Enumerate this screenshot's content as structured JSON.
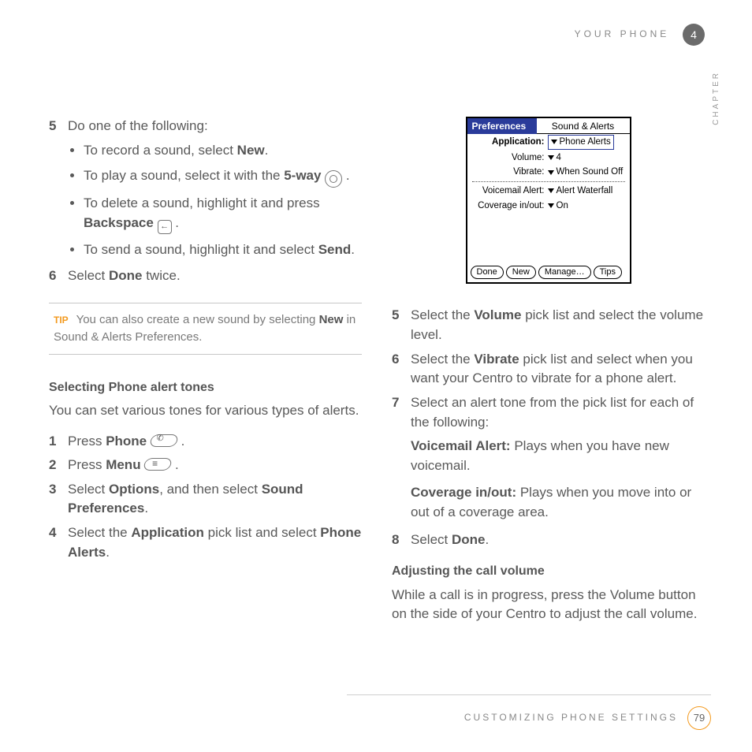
{
  "header": {
    "section": "YOUR PHONE",
    "chapter_number": "4",
    "vertical": "CHAPTER"
  },
  "leftCol": {
    "step5_n": "5",
    "step5_intro": "Do one of the following:",
    "bullets": {
      "b0a": "To record a sound, select ",
      "b0b": "New",
      "b0c": ".",
      "b1a": "To play a sound, select it with the ",
      "b1b": "5-way",
      "b1c": " .",
      "b2a": "To delete a sound, highlight it and press ",
      "b2b": "Backspace",
      "b2c": " .",
      "b3a": "To send a sound, highlight it and select ",
      "b3b": "Send",
      "b3c": "."
    },
    "step6_n": "6",
    "step6a": "Select ",
    "step6b": "Done",
    "step6c": " twice.",
    "tip": {
      "label": "TIP",
      "t1": "You can also create a new sound by selecting ",
      "t2": "New",
      "t3": " in Sound & Alerts Preferences."
    },
    "h_select": "Selecting Phone alert tones",
    "p_select": "You can set various tones for various types of alerts.",
    "s1n": "1",
    "s1a": "Press ",
    "s1b": "Phone",
    "s1c": " .",
    "s2n": "2",
    "s2a": "Press ",
    "s2b": "Menu",
    "s2c": " .",
    "s3n": "3",
    "s3a": "Select ",
    "s3b": "Options",
    "s3c": ", and then select ",
    "s3d": "Sound Preferences",
    "s3e": ".",
    "s4n": "4",
    "s4a": "Select the ",
    "s4b": "Application",
    "s4c": " pick list and select ",
    "s4d": "Phone Alerts",
    "s4e": "."
  },
  "palm": {
    "title_left": "Preferences",
    "title_right": "Sound & Alerts",
    "r1l": "Application:",
    "r1v": "Phone Alerts",
    "r2l": "Volume:",
    "r2v": "4",
    "r3l": "Vibrate:",
    "r3v": "When Sound Off",
    "r4l": "Voicemail Alert:",
    "r4v": "Alert Waterfall",
    "r5l": "Coverage in/out:",
    "r5v": "On",
    "btn_done": "Done",
    "btn_new": "New",
    "btn_manage": "Manage…",
    "btn_tips": "Tips"
  },
  "rightCol": {
    "s5n": "5",
    "s5a": "Select the ",
    "s5b": "Volume",
    "s5c": " pick list and select the volume level.",
    "s6n": "6",
    "s6a": "Select the ",
    "s6b": "Vibrate",
    "s6c": " pick list and select when you want your Centro to vibrate for a phone alert.",
    "s7n": "7",
    "s7t": "Select an alert tone from the pick list for each of the following:",
    "vm_b": "Voicemail Alert:",
    "vm_t": " Plays when you have new voicemail.",
    "cov_b": "Coverage in/out:",
    "cov_t": " Plays when you move into or out of a coverage area.",
    "s8n": "8",
    "s8a": "Select ",
    "s8b": "Done",
    "s8c": ".",
    "h_adj": "Adjusting the call volume",
    "p_adj": "While a call is in progress, press the Volume button on the side of your Centro to adjust the call volume."
  },
  "footer": {
    "text": "CUSTOMIZING PHONE SETTINGS",
    "page": "79"
  }
}
